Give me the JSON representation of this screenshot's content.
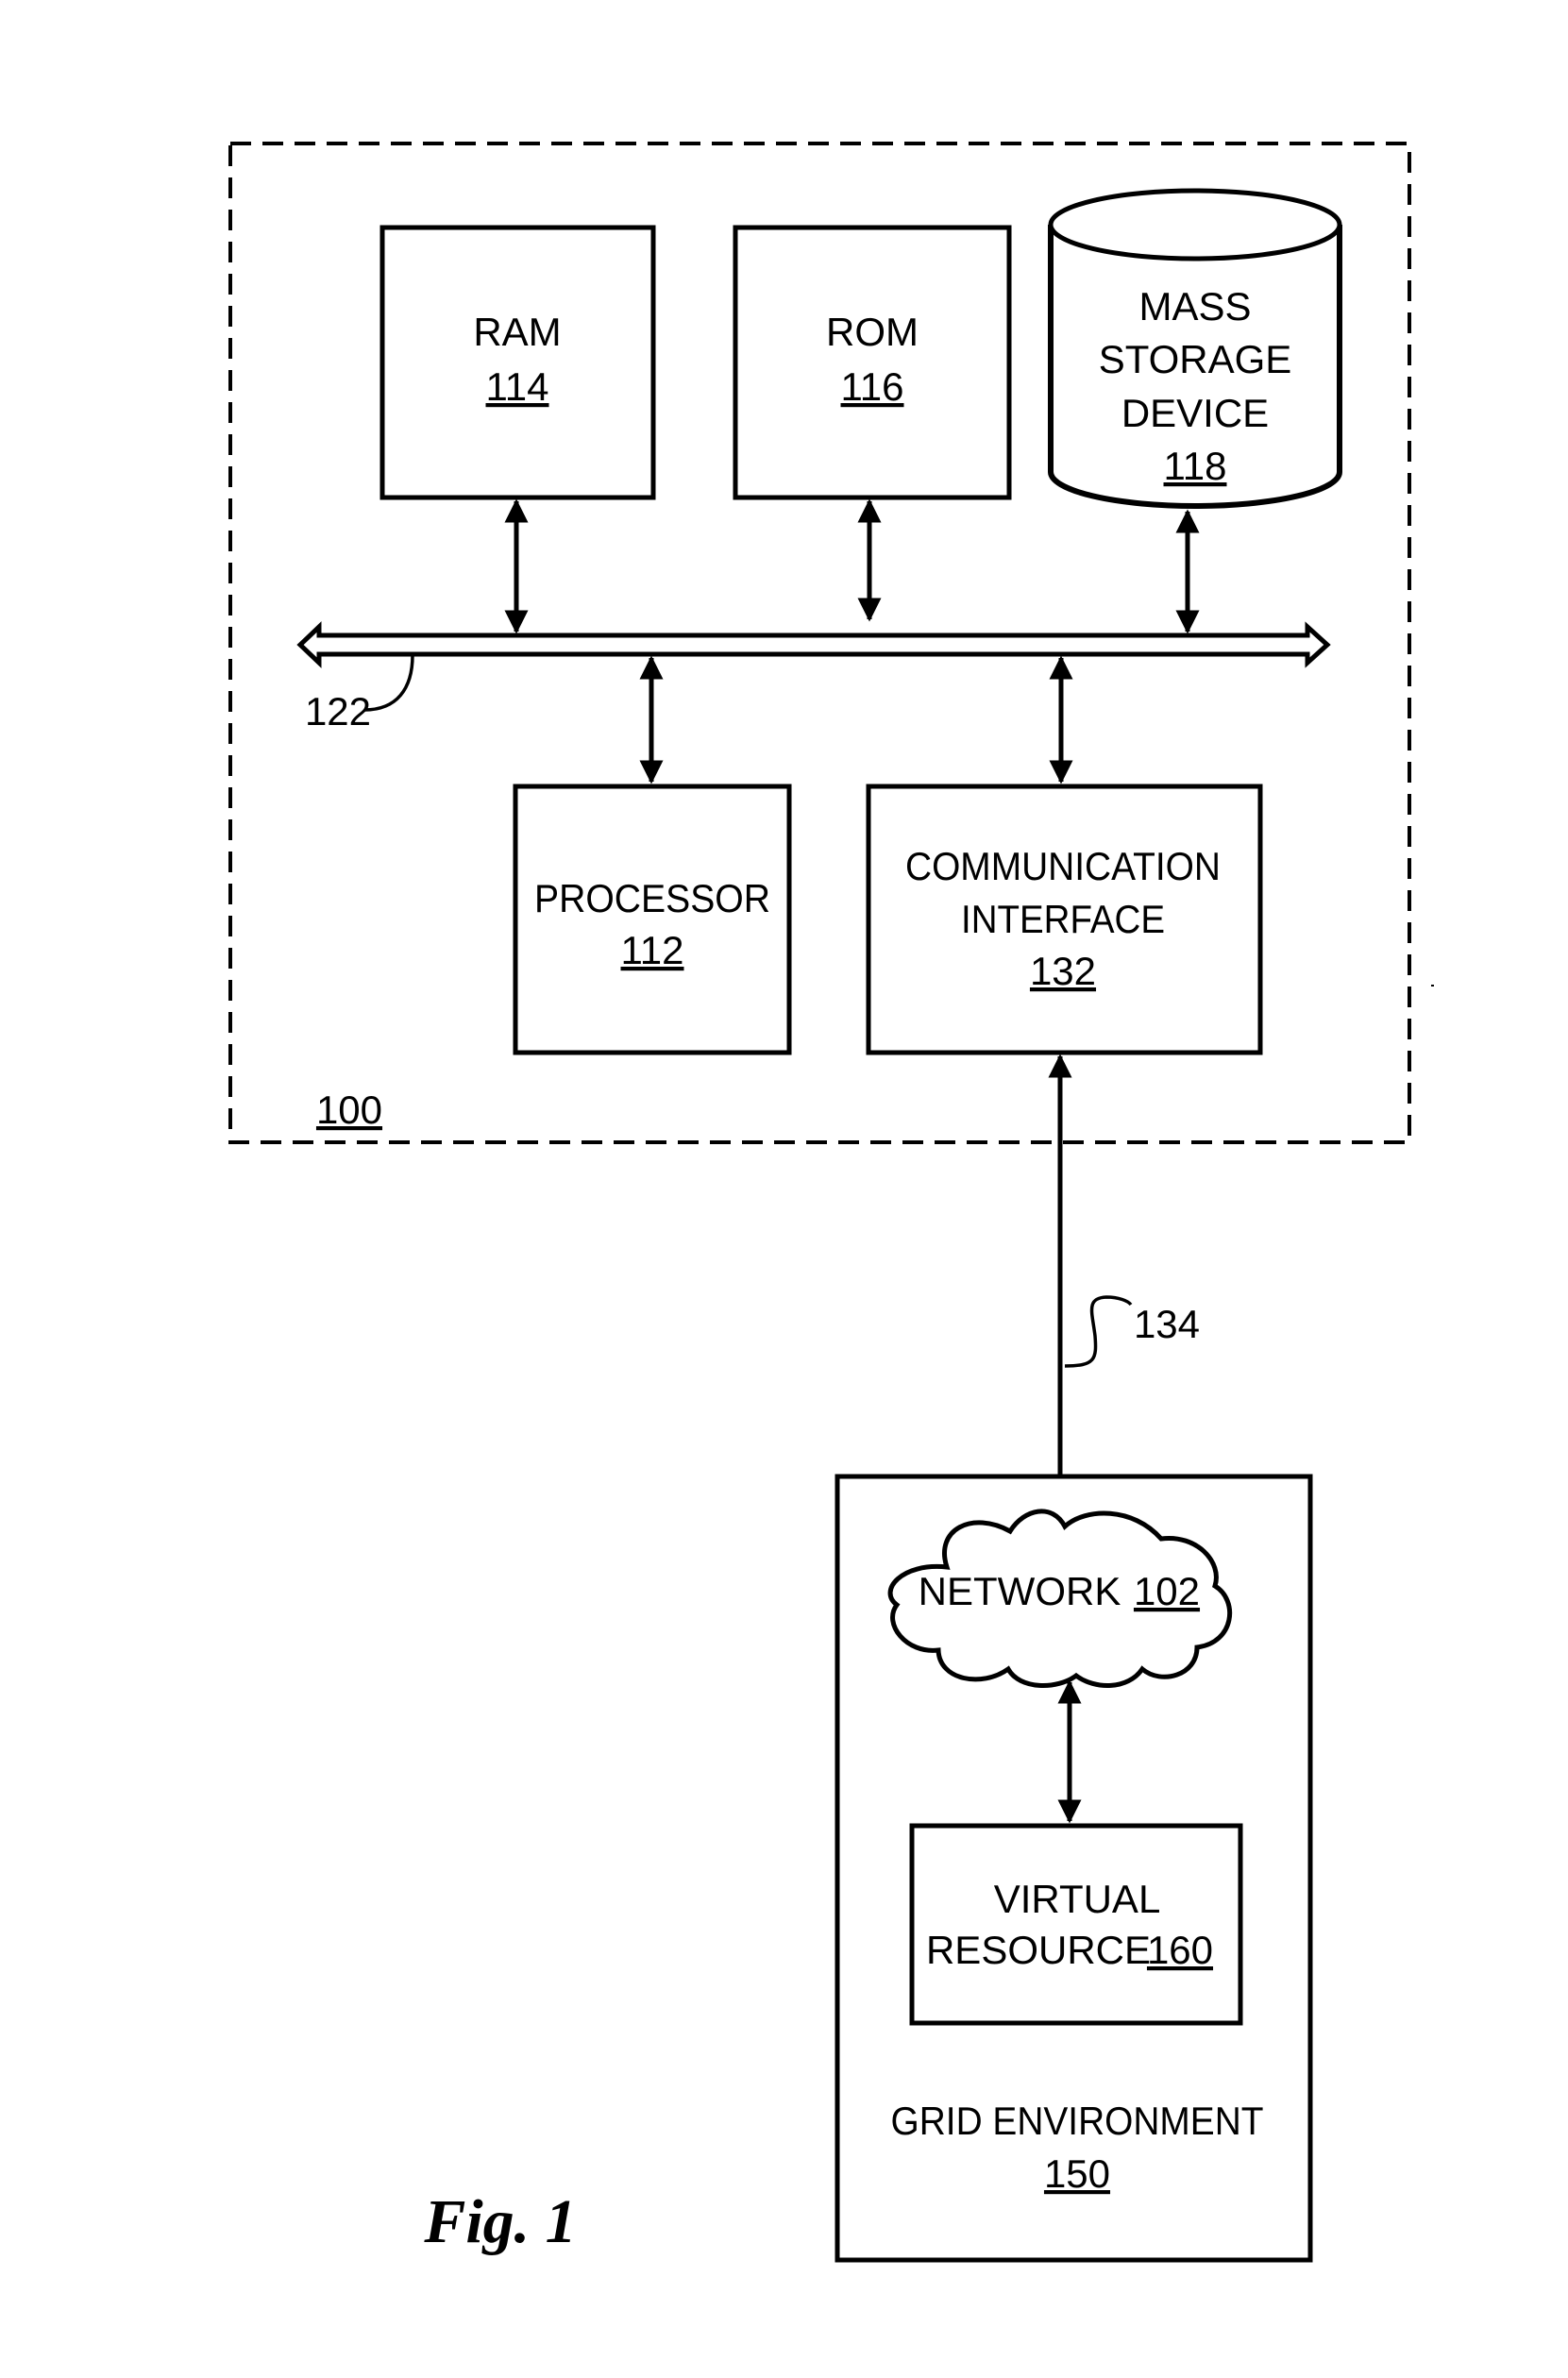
{
  "figure": {
    "caption": "Fig. 1",
    "system": {
      "ref": "100",
      "bus_ref": "122",
      "components": {
        "ram": {
          "label": "RAM",
          "ref": "114"
        },
        "rom": {
          "label": "ROM",
          "ref": "116"
        },
        "mass_storage": {
          "label_lines": [
            "MASS",
            "STORAGE",
            "DEVICE"
          ],
          "ref": "118"
        },
        "processor": {
          "label": "PROCESSOR",
          "ref": "112"
        },
        "communication_interface": {
          "label_lines": [
            "COMMUNICATION",
            "INTERFACE"
          ],
          "ref": "132"
        }
      }
    },
    "link_ref": "134",
    "grid_environment": {
      "label": "GRID ENVIRONMENT",
      "ref": "150",
      "network": {
        "label": "NETWORK",
        "ref": "102"
      },
      "virtual_resource": {
        "label_line1": "VIRTUAL",
        "label_line2": "RESOURCE",
        "ref": "160"
      }
    }
  }
}
